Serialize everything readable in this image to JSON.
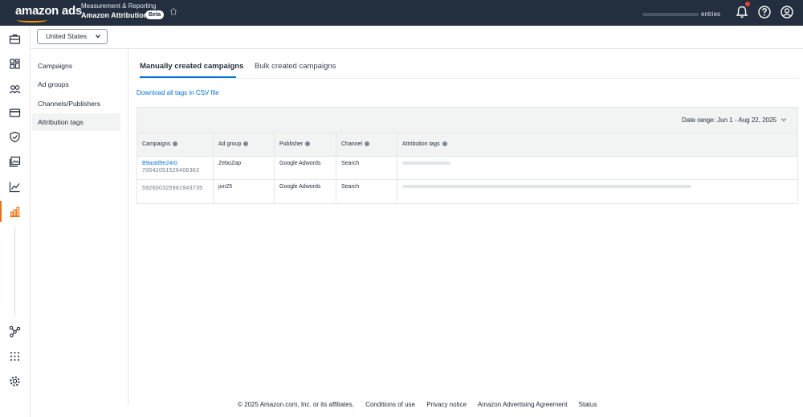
{
  "header": {
    "logo_text": "amazon ads",
    "crumb_top": "Measurement & Reporting",
    "app_title": "Amazon Attribution",
    "beta_badge": "Beta",
    "account_text": "entries",
    "accent_color": "#ff9900",
    "icons": [
      "home-icon",
      "bell-icon",
      "help-icon",
      "account-icon"
    ]
  },
  "rail": {
    "icons": [
      "briefcase-icon",
      "dashboard-icon",
      "audiences-icon",
      "payment-icon",
      "brand-safety-icon",
      "creative-icon",
      "analytics-icon",
      "measurement-icon",
      "integrations-icon",
      "apps-icon",
      "settings-icon"
    ]
  },
  "country_select": {
    "value": "United States"
  },
  "leftnav": {
    "items": [
      {
        "label": "Campaigns"
      },
      {
        "label": "Ad groups"
      },
      {
        "label": "Channels/Publishers"
      },
      {
        "label": "Attribution tags",
        "active": true
      }
    ]
  },
  "tabs": [
    {
      "label": "Manually created campaigns",
      "active": true
    },
    {
      "label": "Bulk created campaigns"
    }
  ],
  "csv_link": "Download all tags in CSV file",
  "table": {
    "date_range": "Date range: Jun 1 - Aug 22, 2025",
    "columns": [
      "Campaigns",
      "Ad group",
      "Publisher",
      "Channel",
      "Attribution tags"
    ],
    "rows": [
      {
        "campaign_name": "B9astd9e24r0",
        "campaign_id": "70042051526406362",
        "ad_group": "ZeboZap",
        "publisher": "Google Adwords",
        "channel": "Search"
      },
      {
        "campaign_name": "",
        "campaign_id": "592600325981943735",
        "ad_group": "jun25",
        "publisher": "Google Adwords",
        "channel": "Search"
      }
    ]
  },
  "footer": {
    "copyright": "© 2025 Amazon.com, Inc. or its affiliates.",
    "links": [
      "Conditions of use",
      "Privacy notice",
      "Amazon Advertising Agreement",
      "Status"
    ]
  }
}
